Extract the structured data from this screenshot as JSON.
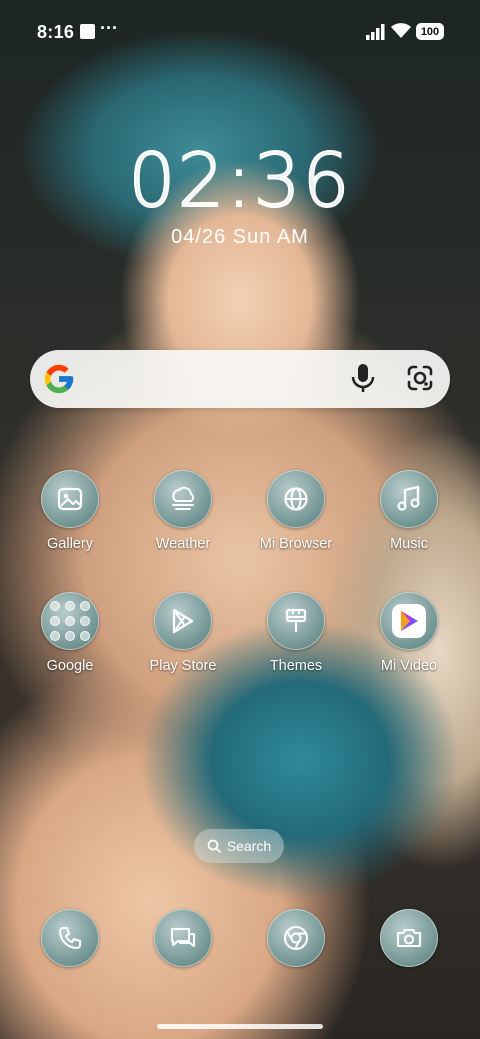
{
  "status_bar": {
    "time": "8:16",
    "more": "···",
    "battery": "100"
  },
  "clock": {
    "time": "02:36",
    "date": "04/26 Sun AM"
  },
  "search": {
    "mic_icon": "mic-icon",
    "lens_icon": "google-lens-icon"
  },
  "apps": {
    "row1": [
      {
        "label": "Gallery",
        "icon": "gallery-icon"
      },
      {
        "label": "Weather",
        "icon": "weather-icon"
      },
      {
        "label": "Mi Browser",
        "icon": "globe-icon"
      },
      {
        "label": "Music",
        "icon": "music-icon"
      }
    ],
    "row2": [
      {
        "label": "Google",
        "icon": "folder-icon"
      },
      {
        "label": "Play Store",
        "icon": "play-store-icon"
      },
      {
        "label": "Themes",
        "icon": "brush-icon"
      },
      {
        "label": "Mi Video",
        "icon": "mi-video-icon"
      }
    ]
  },
  "search_pill": {
    "label": "Search"
  },
  "dock": [
    {
      "name": "Phone",
      "icon": "phone-icon"
    },
    {
      "name": "Messages",
      "icon": "message-icon"
    },
    {
      "name": "Chrome",
      "icon": "chrome-icon"
    },
    {
      "name": "Camera",
      "icon": "camera-icon"
    }
  ]
}
